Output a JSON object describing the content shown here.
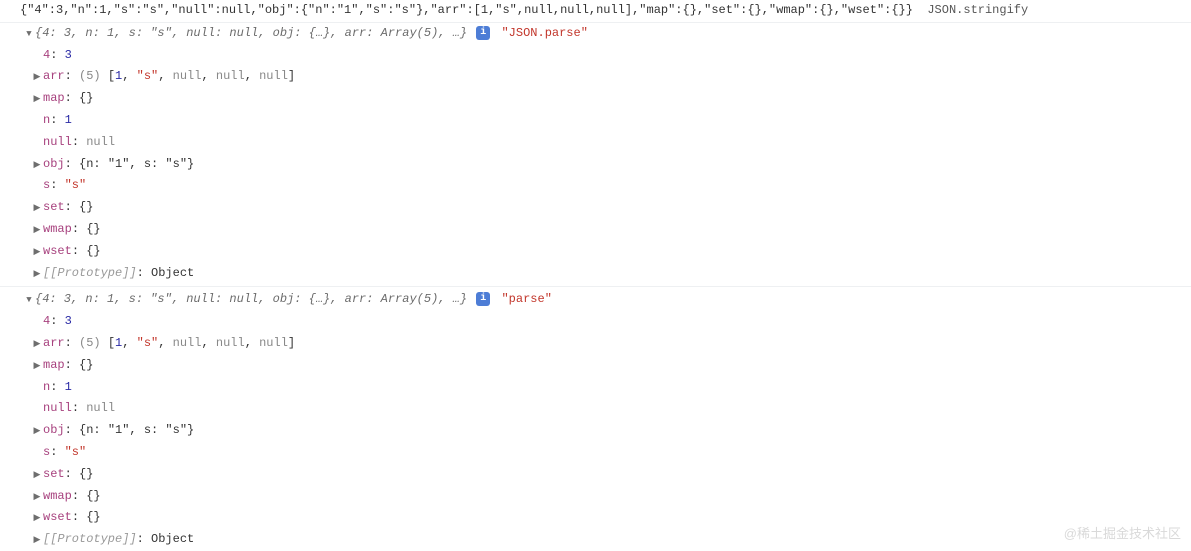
{
  "topLine": {
    "json": "{\"4\":3,\"n\":1,\"s\":\"s\",\"null\":null,\"obj\":{\"n\":\"1\",\"s\":\"s\"},\"arr\":[1,\"s\",null,null,null],\"map\":{},\"set\":{},\"wmap\":{},\"wset\":{}}",
    "trailer": "JSON.stringify"
  },
  "groups": [
    {
      "summary": "{4: 3, n: 1, s: \"s\", null: null, obj: {…}, arr: Array(5), …}",
      "label": "\"JSON.parse\"",
      "props": [
        {
          "arrow": "",
          "key": "4",
          "raw": ": ",
          "valType": "num",
          "val": "3"
        },
        {
          "arrow": "r",
          "key": "arr",
          "raw": ": ",
          "post": "(5) [1, \"s\", null, null, null]"
        },
        {
          "arrow": "r",
          "key": "map",
          "raw": ": ",
          "valType": "obj",
          "val": "{}"
        },
        {
          "arrow": "",
          "key": "n",
          "raw": ": ",
          "valType": "num",
          "val": "1"
        },
        {
          "arrow": "",
          "key": "null",
          "raw": ": ",
          "valType": "nul",
          "val": "null"
        },
        {
          "arrow": "r",
          "key": "obj",
          "raw": ": ",
          "post": "{n: \"1\", s: \"s\"}"
        },
        {
          "arrow": "",
          "key": "s",
          "raw": ": ",
          "valType": "str",
          "val": "\"s\""
        },
        {
          "arrow": "r",
          "key": "set",
          "raw": ": ",
          "valType": "obj",
          "val": "{}"
        },
        {
          "arrow": "r",
          "key": "wmap",
          "raw": ": ",
          "valType": "obj",
          "val": "{}"
        },
        {
          "arrow": "r",
          "key": "wset",
          "raw": ": ",
          "valType": "obj",
          "val": "{}"
        },
        {
          "arrow": "r",
          "protoKey": "[[Prototype]]",
          "raw": ": ",
          "valType": "obj",
          "val": "Object"
        }
      ]
    },
    {
      "summary": "{4: 3, n: 1, s: \"s\", null: null, obj: {…}, arr: Array(5), …}",
      "label": "\"parse\"",
      "props": [
        {
          "arrow": "",
          "key": "4",
          "raw": ": ",
          "valType": "num",
          "val": "3"
        },
        {
          "arrow": "r",
          "key": "arr",
          "raw": ": ",
          "post": "(5) [1, \"s\", null, null, null]"
        },
        {
          "arrow": "r",
          "key": "map",
          "raw": ": ",
          "valType": "obj",
          "val": "{}"
        },
        {
          "arrow": "",
          "key": "n",
          "raw": ": ",
          "valType": "num",
          "val": "1"
        },
        {
          "arrow": "",
          "key": "null",
          "raw": ": ",
          "valType": "nul",
          "val": "null"
        },
        {
          "arrow": "r",
          "key": "obj",
          "raw": ": ",
          "post": "{n: \"1\", s: \"s\"}"
        },
        {
          "arrow": "",
          "key": "s",
          "raw": ": ",
          "valType": "str",
          "val": "\"s\""
        },
        {
          "arrow": "r",
          "key": "set",
          "raw": ": ",
          "valType": "obj",
          "val": "{}"
        },
        {
          "arrow": "r",
          "key": "wmap",
          "raw": ": ",
          "valType": "obj",
          "val": "{}"
        },
        {
          "arrow": "r",
          "key": "wset",
          "raw": ": ",
          "valType": "obj",
          "val": "{}"
        },
        {
          "arrow": "r",
          "protoKey": "[[Prototype]]",
          "raw": ": ",
          "valType": "obj",
          "val": "Object"
        }
      ]
    }
  ],
  "watermark": "@稀土掘金技术社区",
  "infoGlyph": "i"
}
